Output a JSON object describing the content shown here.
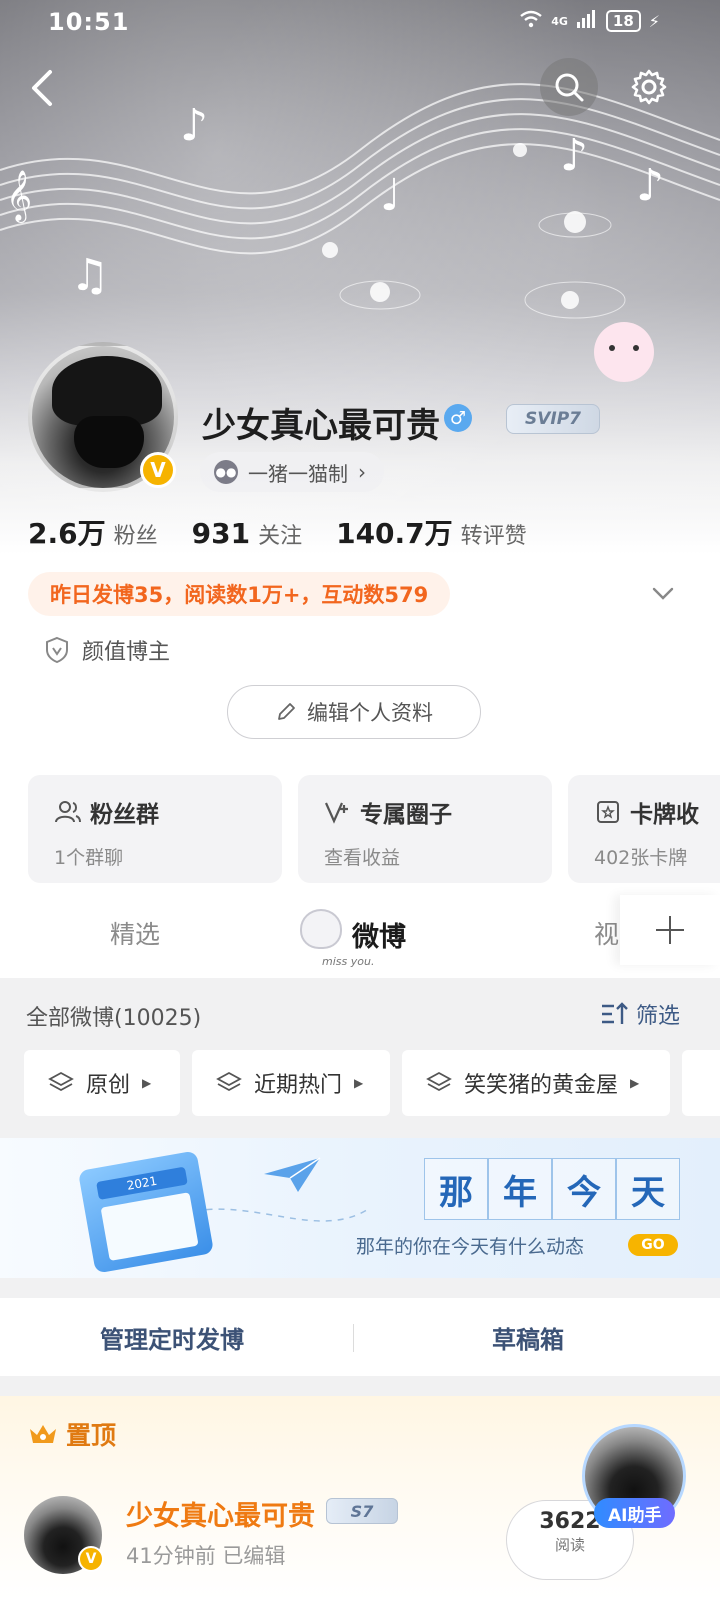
{
  "status_bar": {
    "time": "10:51",
    "network": "4G",
    "battery": "18"
  },
  "profile": {
    "name": "少女真心最可贵",
    "svip_label": "SVIP7",
    "group_chip": "一猪一猫制",
    "stats": [
      {
        "value": "2.6万",
        "label": "粉丝"
      },
      {
        "value": "931",
        "label": "关注"
      },
      {
        "value": "140.7万",
        "label": "转评赞"
      }
    ],
    "activity": "昨日发博35，阅读数1万+，互动数579",
    "tag": "颜值博主",
    "edit_button": "编辑个人资料"
  },
  "cards": [
    {
      "title": "粉丝群",
      "sub": "1个群聊",
      "icon": "users-icon"
    },
    {
      "title": "专属圈子",
      "sub": "查看收益",
      "icon": "v-plus-icon"
    },
    {
      "title": "卡牌收",
      "sub": "402张卡牌",
      "icon": "card-icon"
    }
  ],
  "tabs": [
    {
      "label": "精选"
    },
    {
      "label": "微博",
      "active": true,
      "mascot_text": "miss you."
    },
    {
      "label": "视"
    }
  ],
  "feed": {
    "all_count": "全部微博(10025)",
    "filter": "筛选",
    "chips": [
      "原创",
      "近期热门",
      "笑笑猪的黄金屋"
    ]
  },
  "banner": {
    "calendar_year": "2021",
    "title_chars": [
      "那",
      "年",
      "今",
      "天"
    ],
    "subtitle": "那年的你在今天有什么动态",
    "go": "GO"
  },
  "manage": {
    "scheduled": "管理定时发博",
    "drafts": "草稿箱"
  },
  "pinned": {
    "label": "置顶",
    "post_name": "少女真心最可贵",
    "vip_label": "S7",
    "meta": "41分钟前   已编辑",
    "read_count": "3622",
    "read_label": "阅读",
    "ai_label": "AI助手"
  },
  "colors": {
    "accent_orange": "#f2661e",
    "link_blue": "#3c5276",
    "verified_gold": "#f6b300"
  }
}
